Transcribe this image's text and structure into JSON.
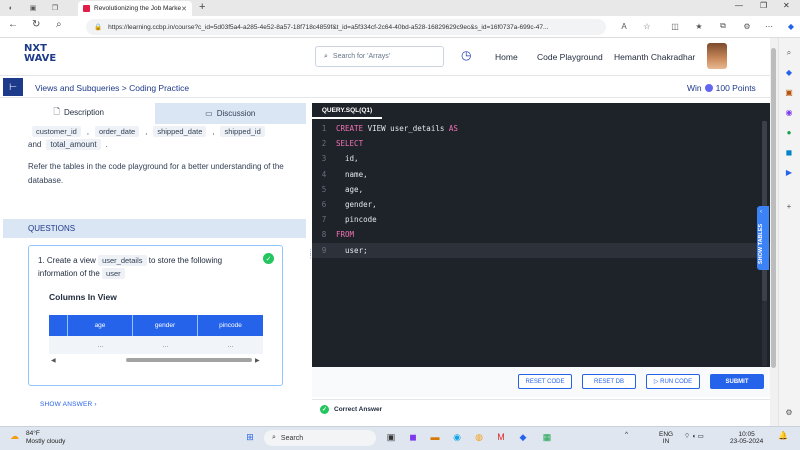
{
  "browser": {
    "tab_title": "Revolutionizing the Job Market |",
    "url": "https://learning.ccbp.in/course?c_id=5d03f5a4-a285-4e52-8a57-18f718c4859f&t_id=a5f334cf-2c64-40bd-a528-16829629c9ec&s_id=16f0737a-699c-47..."
  },
  "header": {
    "logo_line1": "NXT",
    "logo_line2": "WAVE",
    "search_placeholder": "Search for 'Arrays'",
    "nav": [
      "Home",
      "Code Playground"
    ],
    "user_name": "Hemanth Chakradhar"
  },
  "subheader": {
    "breadcrumb": "Views and Subqueries > Coding Practice",
    "win_label": "Win",
    "points": "100 Points"
  },
  "left_panel": {
    "tabs": [
      "Description",
      "Discussion"
    ],
    "top_chips": [
      "customer_id",
      "order_date",
      "shipped_date",
      "shipped_id"
    ],
    "and_text": "and",
    "and_chip": "total_amount",
    "description": "Refer the tables in the code playground for a better understanding of the database.",
    "questions_label": "QUESTIONS",
    "question": {
      "number": "1.",
      "part1": "Create a view",
      "chip1": "user_details",
      "part2": "to store the following information of the",
      "chip2": "user"
    },
    "columns_title": "Columns In View",
    "table_columns": [
      "age",
      "gender",
      "pincode"
    ],
    "table_row": [
      "...",
      "...",
      "..."
    ],
    "show_answer": "SHOW ANSWER"
  },
  "editor": {
    "file_tab": "QUERY.SQL(Q1)",
    "lines": [
      {
        "n": "1",
        "kw": "CREATE",
        "rest": " VIEW user_details ",
        "kw2": "AS"
      },
      {
        "n": "2",
        "kw": "SELECT",
        "rest": "",
        "kw2": ""
      },
      {
        "n": "3",
        "kw": "",
        "rest": "  id,",
        "kw2": ""
      },
      {
        "n": "4",
        "kw": "",
        "rest": "  name,",
        "kw2": ""
      },
      {
        "n": "5",
        "kw": "",
        "rest": "  age,",
        "kw2": ""
      },
      {
        "n": "6",
        "kw": "",
        "rest": "  gender,",
        "kw2": ""
      },
      {
        "n": "7",
        "kw": "",
        "rest": "  pincode",
        "kw2": ""
      },
      {
        "n": "8",
        "kw": "FROM",
        "rest": "",
        "kw2": ""
      },
      {
        "n": "9",
        "kw": "",
        "rest": "  user;",
        "kw2": ""
      }
    ],
    "show_tables": "SHOW TABLES",
    "buttons": {
      "reset_code": "RESET CODE",
      "reset_db": "RESET DB",
      "run_code": "RUN CODE",
      "submit": "SUBMIT"
    },
    "result": "Correct Answer"
  },
  "taskbar": {
    "temp": "84°F",
    "weather": "Mostly cloudy",
    "search": "Search",
    "lang1": "ENG",
    "lang2": "IN",
    "time": "10:05",
    "date": "23-05-2024"
  }
}
